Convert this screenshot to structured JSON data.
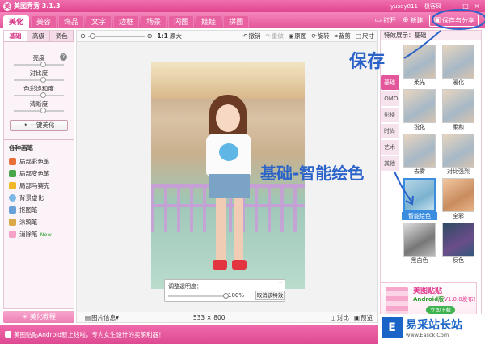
{
  "window": {
    "title": "美图秀秀 3.1.3",
    "user": "yusey811",
    "link": "极客风",
    "controls": [
      "–",
      "□",
      "×"
    ]
  },
  "main_tabs": [
    "美化",
    "美容",
    "饰品",
    "文字",
    "边框",
    "场景",
    "闪图",
    "娃娃",
    "拼图"
  ],
  "top_tools": {
    "open": "打开",
    "new": "新建",
    "save_share": "保存与分享"
  },
  "left_panel": {
    "tabs": [
      "基础",
      "高级",
      "调色"
    ],
    "sliders": [
      {
        "label": "亮度",
        "value": 0.5
      },
      {
        "label": "对比度",
        "value": 0.5
      },
      {
        "label": "色彩饱和度",
        "value": 0.5
      },
      {
        "label": "清晰度",
        "value": 0.5
      }
    ],
    "one_key": "一键美化",
    "section_title": "各种画笔",
    "brushes": [
      "局部彩色笔",
      "局部变色笔",
      "局部马赛克",
      "背景虚化",
      "抠图笔",
      "涂鸦笔",
      "消除笔"
    ],
    "new_badge": "New",
    "tutorial": "美化教程"
  },
  "canvas": {
    "zoom_ratio": "1:1",
    "original": "原大",
    "tools": [
      "撤销",
      "重做",
      "原图",
      "旋转",
      "裁剪",
      "尺寸"
    ],
    "opacity_label": "调整透明度：",
    "opacity_value": "100%",
    "cancel_effect": "取消该特效",
    "image_info": "图片信息",
    "dimensions": "533 × 800",
    "compare": "对比",
    "preview": "预览"
  },
  "right_panel": {
    "header": "特效展示：基础",
    "categories": [
      "基础",
      "LOMO",
      "影楼",
      "时尚",
      "艺术",
      "其他"
    ],
    "thumbnails": [
      "",
      "",
      "柔光",
      "暖化",
      "锐化",
      "柔和",
      "去雾",
      "对比强烈",
      "智能绘色",
      "全彩",
      "黑白色",
      "反色",
      "",
      ""
    ],
    "selected": "智能绘色"
  },
  "ad": {
    "title": "美图贴贴",
    "sub_prefix": "Android版",
    "sub_version": "V1.0.0发布!",
    "button": "立即下载"
  },
  "status": {
    "message": "美图贴贴Android新上线啦，专为女生设计的卖萌利器！"
  },
  "watermark": {
    "logo": "E",
    "title": "易采站长站",
    "url": "www.Easck.Com"
  },
  "annotations": {
    "save": "保存",
    "smart": "基础-智能绘色"
  }
}
